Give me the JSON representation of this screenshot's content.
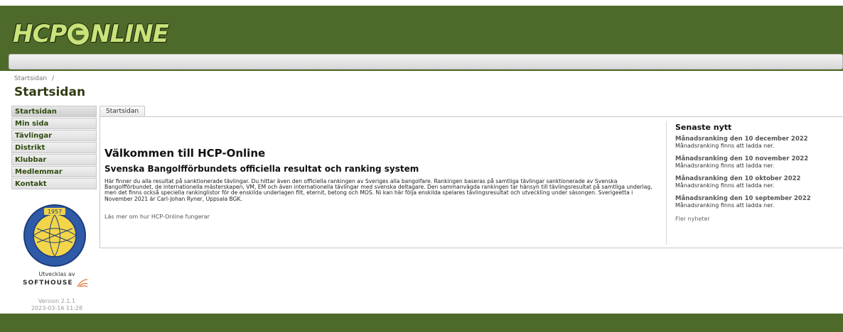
{
  "header": {
    "logo_left": "HCP",
    "logo_right": "NLINE",
    "colors": {
      "brand_green": "#4e6a2a",
      "logo_lime": "#c9e27a"
    }
  },
  "breadcrumb": {
    "item": "Startsidan",
    "separator": "/"
  },
  "page_title": "Startsidan",
  "sidebar": {
    "items": [
      {
        "label": "Startsidan"
      },
      {
        "label": "Min sida"
      },
      {
        "label": "Tävlingar"
      },
      {
        "label": "Distrikt"
      },
      {
        "label": "Klubbar"
      },
      {
        "label": "Medlemmar"
      },
      {
        "label": "Kontakt"
      }
    ],
    "seal_icon": "federation-seal-icon",
    "seal_year": "1957",
    "dev_label": "Utvecklas av",
    "dev_company": "SOFTHOUSE",
    "version": "Version 2.1.1",
    "build_date": "2023-03-16 11:28"
  },
  "tab": {
    "label": "Startsidan"
  },
  "main": {
    "welcome": "Välkommen till HCP-Online",
    "subheading": "Svenska Bangolfförbundets officiella resultat och ranking system",
    "intro": "Här finner du alla resultat på sanktionerade tävlingar. Du hittar även den officiella rankingen av Sveriges alla bangolfare. Rankingen baseras på samtliga tävlingar sanktionerade av Svenska Bangolfförbundet, de internationella mästerskapen, VM, EM och även internationella tävlingar med svenska deltagare. Den sammanvägda rankingen tar hänsyn till tävlingsresultat på samtliga underlag, men det finns också speciella rankinglistor för de enskilda underlagen filt, eternit, betong och MOS. Ni kan här följa enskilda spelares tävlingsresultat och utveckling under säsongen. Sverigeetta i November 2021 är Carl-Johan Ryner, Uppsala BGK.",
    "more_link": "Läs mer om hur HCP-Online fungerar"
  },
  "news": {
    "title": "Senaste nytt",
    "items": [
      {
        "head": "Månadsranking den 10 december 2022",
        "body": "Månadsranking finns att ladda ner."
      },
      {
        "head": "Månadsranking den 10 november 2022",
        "body": "Månadsranking finns att ladda ner."
      },
      {
        "head": "Månadsranking den 10 oktober 2022",
        "body": "Månadsranking finns att ladda ner."
      },
      {
        "head": "Månadsranking den 10 september 2022",
        "body": "Månadsranking finns att ladda ner."
      }
    ],
    "more": "Fler nyheter"
  }
}
